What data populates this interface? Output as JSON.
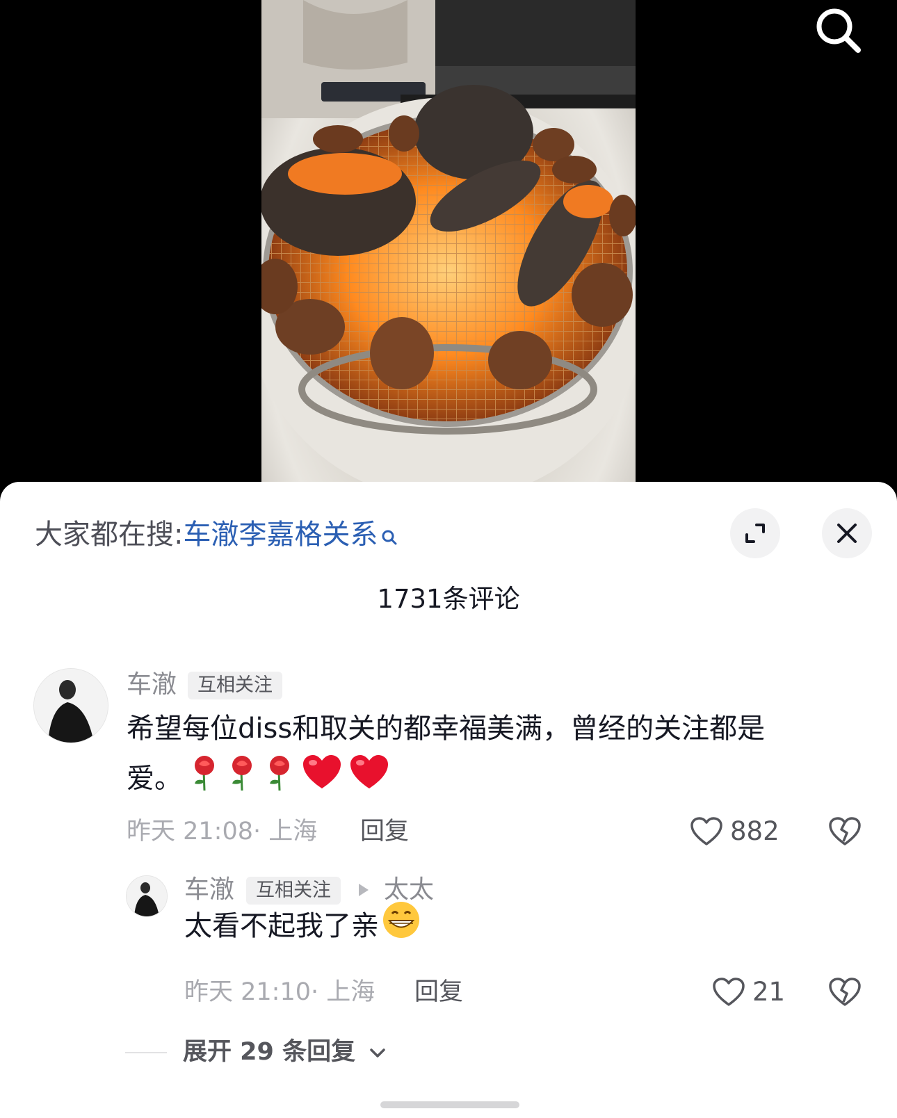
{
  "search_hint": {
    "prefix": "大家都在搜:",
    "query": "车澈李嘉格关系"
  },
  "comment_count": "1731条评论",
  "comments": [
    {
      "username": "车澈",
      "tag": "互相关注",
      "text_line1": "希望每位diss和取关的都幸福美满，曾经的关注都是",
      "text_line2": "爱。",
      "emojis": [
        "rose-emoji",
        "rose-emoji",
        "rose-emoji",
        "heart-emoji",
        "heart-emoji"
      ],
      "time": "昨天 21:08",
      "location": "· 上海",
      "reply_label": "回复",
      "likes": "882"
    }
  ],
  "reply": {
    "username": "车澈",
    "tag": "互相关注",
    "reply_to": "太太",
    "text": "太看不起我了亲",
    "emoji": "grin-emoji",
    "time": "昨天 21:10",
    "location": "· 上海",
    "reply_label": "回复",
    "likes": "21"
  },
  "expand_replies": "展开 29 条回复",
  "icons": [
    "search-icon",
    "expand-icon",
    "close-icon",
    "heart-outline-icon",
    "broken-heart-icon",
    "chevron-down-icon"
  ],
  "colors": {
    "link": "#2b5fb3",
    "heart_emoji": "#e8112d",
    "rose_emoji": "#d6252f"
  }
}
